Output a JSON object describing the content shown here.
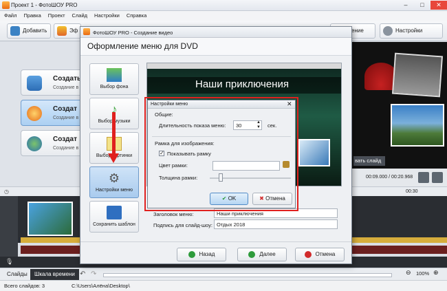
{
  "window": {
    "title": "Проект 1 - ФотоШОУ PRO"
  },
  "menubar": [
    "Файл",
    "Правка",
    "Проект",
    "Слайд",
    "Настройки",
    "Справка"
  ],
  "toolbar": {
    "add_label": "Добавить",
    "effects_label": "Эф",
    "save_photo_label": "ение фото",
    "project_settings_label": "Настройки проекта"
  },
  "leftpanel": {
    "items": [
      {
        "title": "Создать",
        "sub": "Создание в"
      },
      {
        "title": "Создат",
        "sub": "Создание в"
      },
      {
        "title": "Создат",
        "sub": "Создание в"
      }
    ]
  },
  "preview": {
    "caption": "вать слайд",
    "time": "00:09.000 / 00:20.968"
  },
  "timeline": {
    "ruler_mark": "00:30"
  },
  "bottom": {
    "tab_slides": "Слайды",
    "tab_timeline": "Шкала времени",
    "zoom": "100%"
  },
  "status": {
    "slides": "Всего слайдов: 3",
    "path": "C:\\Users\\Алёна\\Desktop\\"
  },
  "dialog": {
    "title": "ФотоШОУ PRO - Создание видео",
    "header": "Оформление меню для DVD",
    "side_buttons": [
      "Выбор фона",
      "Выбор музыки",
      "Выбор картинки",
      "Настройки меню",
      "Сохранить шаблон"
    ],
    "slide_title": "Наши приключения",
    "menu_title_label": "Заголовок меню:",
    "menu_title_value": "Наши приключения",
    "caption_label": "Подпись для слайд-шоу:",
    "caption_value": "Отдых 2018",
    "back": "Назад",
    "next": "Далее",
    "cancel": "Отмена"
  },
  "menu_settings": {
    "title": "Настройки меню",
    "general": "Общие:",
    "duration_label": "Длительность показа меню:",
    "duration_value": "30",
    "duration_unit": "сек.",
    "frame_section": "Рамка для изображения:",
    "show_frame": "Показывать рамку",
    "show_frame_checked": true,
    "frame_color_label": "Цвет рамки:",
    "frame_width_label": "Толщина рамки:",
    "ok": "OK",
    "cancel": "Отмена"
  },
  "colors": {
    "accent_red": "#e0201e",
    "selected_blue": "#a9cbee"
  }
}
